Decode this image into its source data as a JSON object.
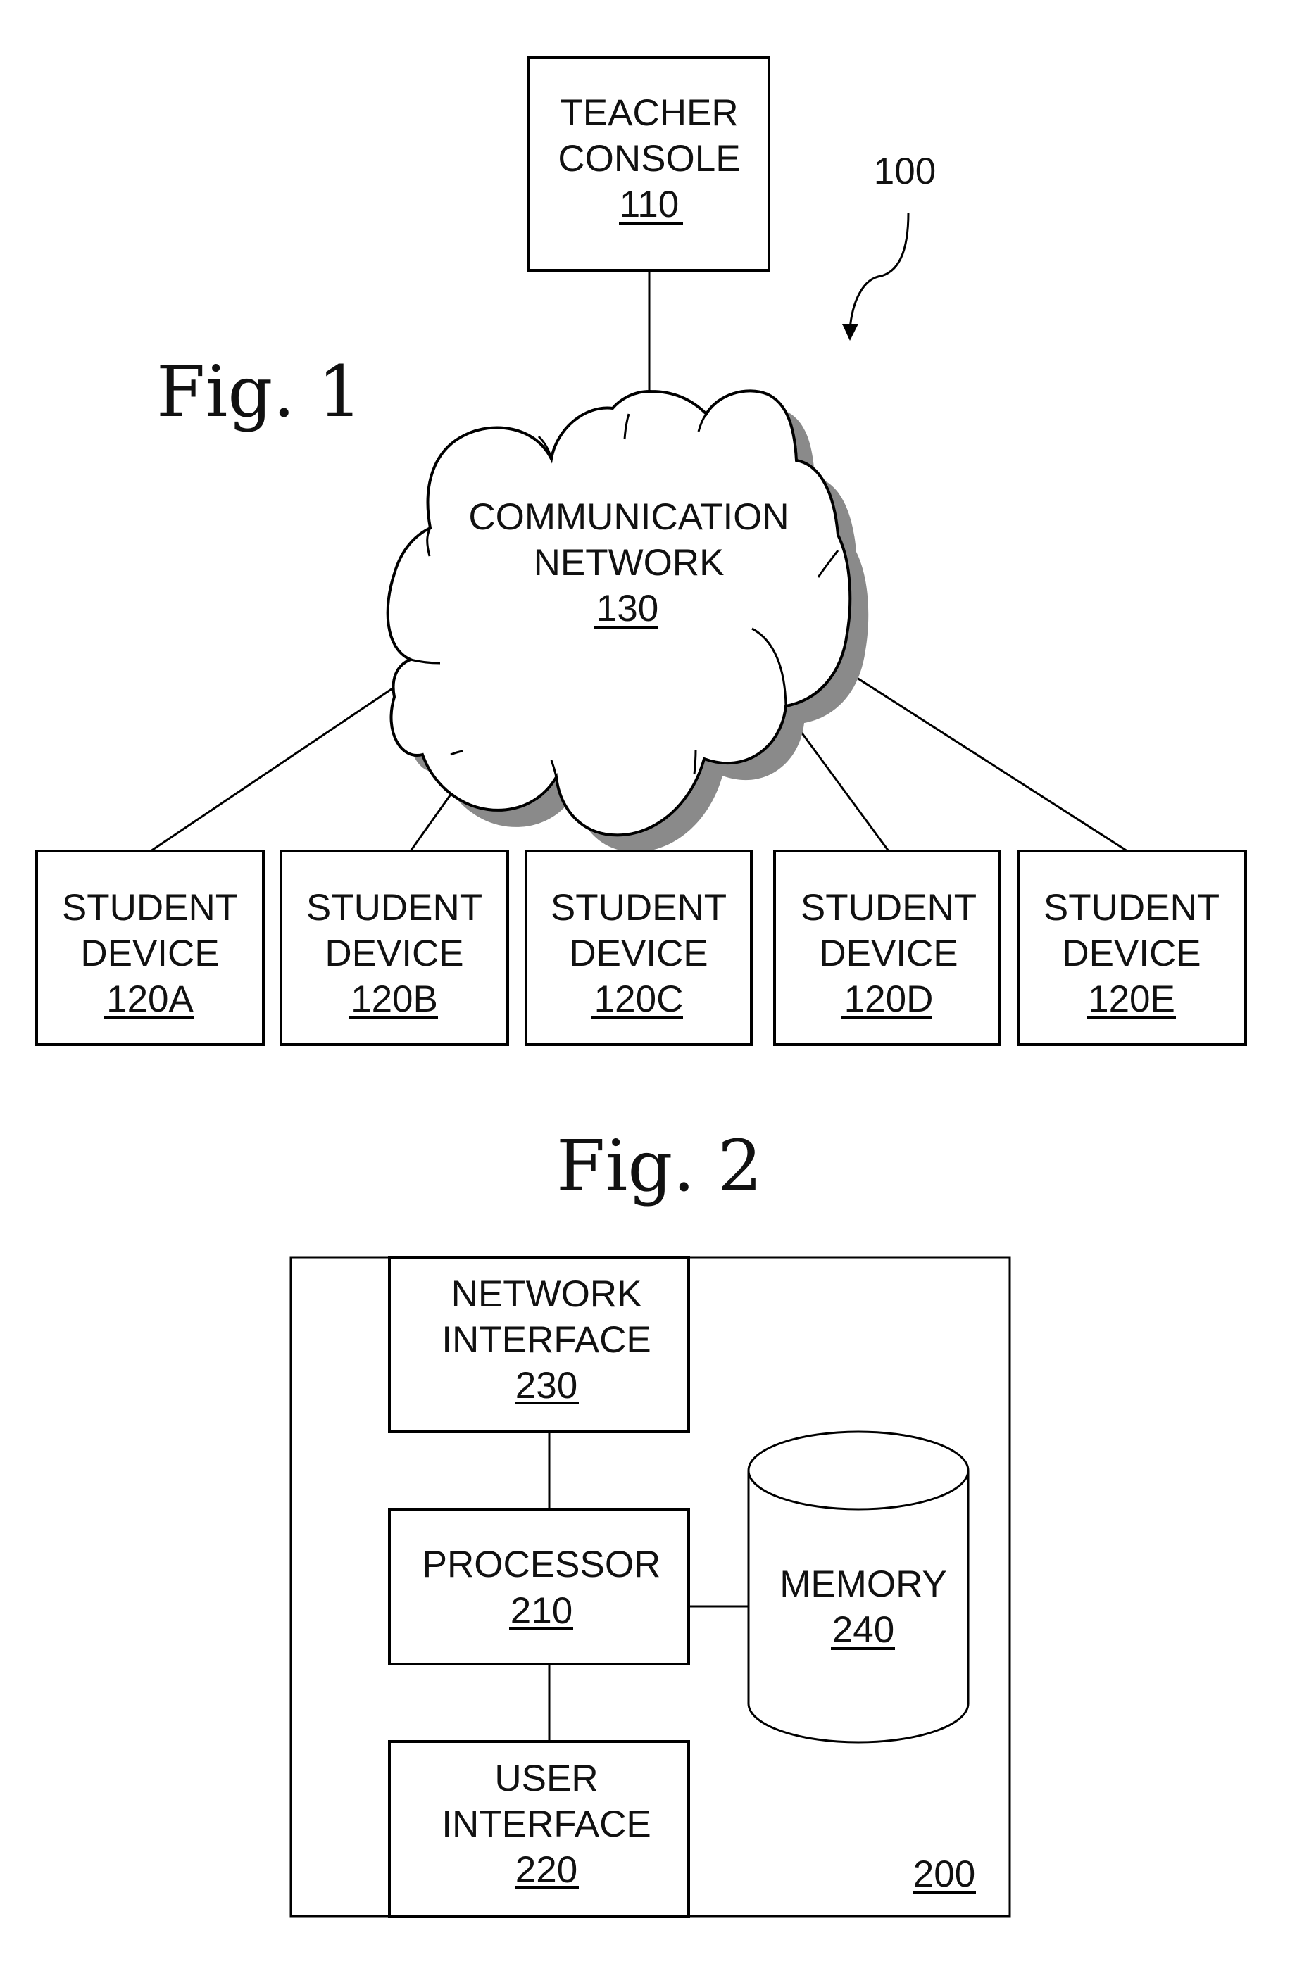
{
  "figure1": {
    "title": "Fig. 1",
    "system_ref": "100",
    "teacher_console": {
      "lines": [
        "TEACHER",
        "CONSOLE"
      ],
      "ref": "110"
    },
    "network": {
      "lines": [
        "COMMUNICATION",
        "NETWORK"
      ],
      "ref": "130"
    },
    "student_devices": [
      {
        "lines": [
          "STUDENT",
          "DEVICE"
        ],
        "ref": "120A"
      },
      {
        "lines": [
          "STUDENT",
          "DEVICE"
        ],
        "ref": "120B"
      },
      {
        "lines": [
          "STUDENT",
          "DEVICE"
        ],
        "ref": "120C"
      },
      {
        "lines": [
          "STUDENT",
          "DEVICE"
        ],
        "ref": "120D"
      },
      {
        "lines": [
          "STUDENT",
          "DEVICE"
        ],
        "ref": "120E"
      }
    ]
  },
  "figure2": {
    "title": "Fig. 2",
    "device_ref": "200",
    "network_interface": {
      "lines": [
        "NETWORK",
        "INTERFACE"
      ],
      "ref": "230"
    },
    "processor": {
      "lines": [
        "PROCESSOR"
      ],
      "ref": "210"
    },
    "user_interface": {
      "lines": [
        "USER",
        "INTERFACE"
      ],
      "ref": "220"
    },
    "memory": {
      "lines": [
        "MEMORY"
      ],
      "ref": "240"
    }
  }
}
